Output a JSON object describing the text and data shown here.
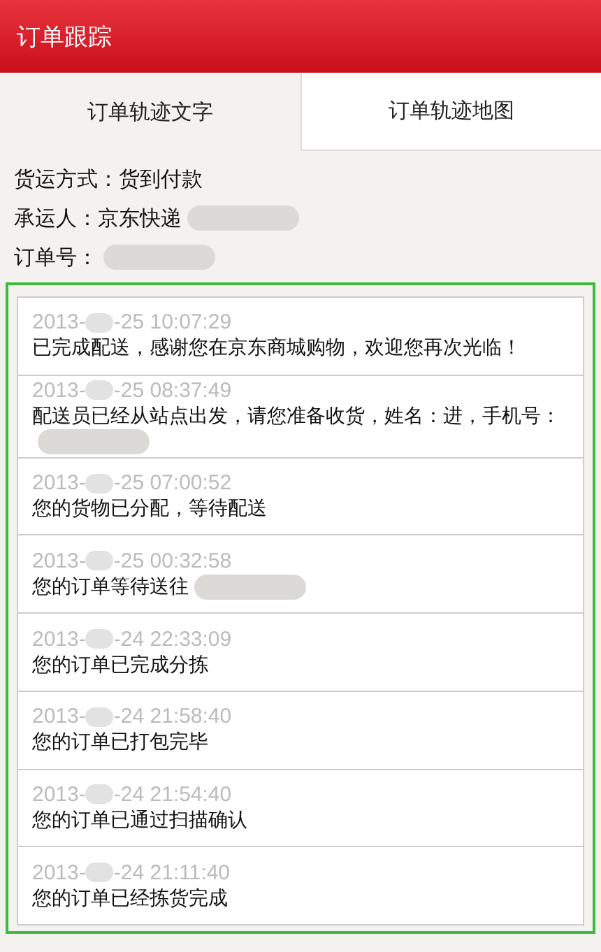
{
  "header": {
    "title": "订单跟踪"
  },
  "tabs": [
    {
      "label": "订单轨迹文字",
      "selected": true
    },
    {
      "label": "订单轨迹地图",
      "selected": false
    }
  ],
  "info": [
    {
      "label": "货运方式：",
      "value": "货到付款",
      "redacted": false
    },
    {
      "label": "承运人：",
      "value": "京东快递",
      "redacted": true
    },
    {
      "label": "订单号：",
      "redacted": true
    }
  ],
  "events": [
    {
      "date_start": "2013-",
      "date_end": "-25 10:07:29",
      "message": "已完成配送，感谢您在京东商城购物，欢迎您再次光临！",
      "redacted": false
    },
    {
      "date_start": "2013-",
      "date_end": "-25 08:37:49",
      "message": "配送员已经从站点出发，请您准备收货，姓名：进，手机号：",
      "redacted": true
    },
    {
      "date_start": "2013-",
      "date_end": "-25 07:00:52",
      "message": "您的货物已分配，等待配送",
      "redacted": false
    },
    {
      "date_start": "2013-",
      "date_end": "-25 00:32:58",
      "message": "您的订单等待送往",
      "redacted": true
    },
    {
      "date_start": "2013-",
      "date_end": "-24 22:33:09",
      "message": "您的订单已完成分拣",
      "redacted": false
    },
    {
      "date_start": "2013-",
      "date_end": "-24 21:58:40",
      "message": "您的订单已打包完毕",
      "redacted": false
    },
    {
      "date_start": "2013-",
      "date_end": "-24 21:54:40",
      "message": "您的订单已通过扫描确认",
      "redacted": false
    },
    {
      "date_start": "2013-",
      "date_end": "-24 21:11:40",
      "message": "您的订单已经拣货完成",
      "redacted": false
    }
  ]
}
